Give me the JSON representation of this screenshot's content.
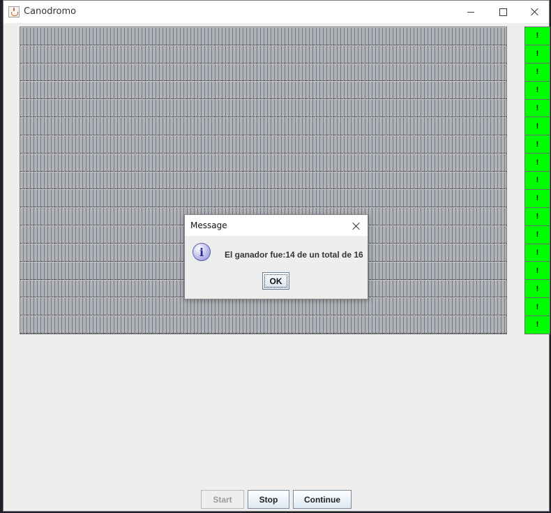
{
  "window": {
    "title": "Canodromo"
  },
  "race": {
    "lanes": 17
  },
  "flags": [
    "!",
    "!",
    "!",
    "!",
    "!",
    "!",
    "!",
    "!",
    "!",
    "!",
    "!",
    "!",
    "!",
    "!",
    "!",
    "!",
    "!"
  ],
  "controls": {
    "start_label": "Start",
    "stop_label": "Stop",
    "continue_label": "Continue"
  },
  "dialog": {
    "title": "Message",
    "message": "El ganador fue:14 de un total de 16",
    "ok_label": "OK"
  },
  "colors": {
    "flag": "#00ff00",
    "track": "#b3b3b3",
    "track_lines": "#6d7894",
    "window_bg": "#eeeeee"
  },
  "icons": {
    "app": "java-coffee-icon",
    "dialog": "info-icon"
  }
}
